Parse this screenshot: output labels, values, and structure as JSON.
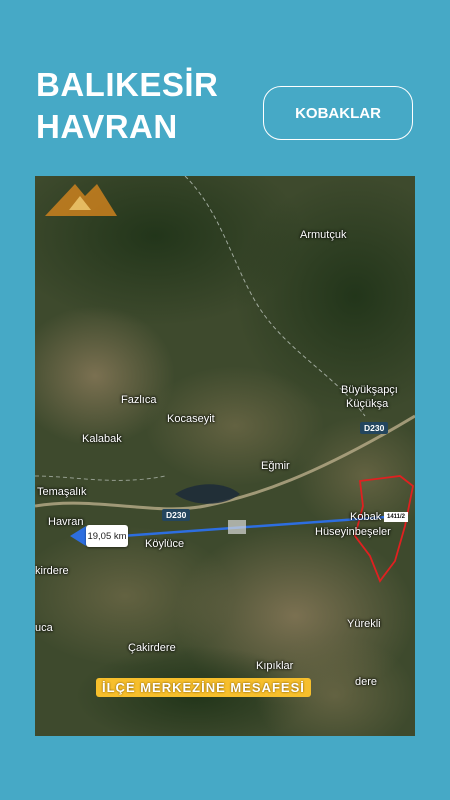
{
  "header": {
    "title_line1": "BALIKESİR",
    "title_line2": "HAVRAN",
    "district_button": "KOBAKLAR"
  },
  "map": {
    "places": {
      "armutcuk": "Armutçuk",
      "fazlica": "Fazlıca",
      "kocaseyit": "Kocaseyit",
      "buyuksapci": "Büyükşapçı",
      "kucuksa": "Küçükşa",
      "kalabak": "Kalabak",
      "egmir": "Eğmir",
      "temasalik": "Temaşalık",
      "havran": "Havran",
      "koylace": "Köylüce",
      "kobak": "Kobak",
      "huseyinbeseler": "Hüseyinbeşeler",
      "kirdere_left": "kirdere",
      "yurekli": "Yürekli",
      "uca": "uca",
      "cakirdere": "Çakirdere",
      "kiprlar": "Kıpıklar",
      "dere_right": "dere"
    },
    "road_labels": {
      "d230_a": "D230",
      "d230_b": "D230"
    },
    "distance": "19,05 km",
    "end_badge": "1411/2",
    "caption": "İLÇE MERKEZİNE MESAFESİ",
    "colors": {
      "route": "#2d6ee0",
      "boundary": "#e02020",
      "caption_bg": "#f7bf2c",
      "background": "#46a9c6"
    }
  }
}
